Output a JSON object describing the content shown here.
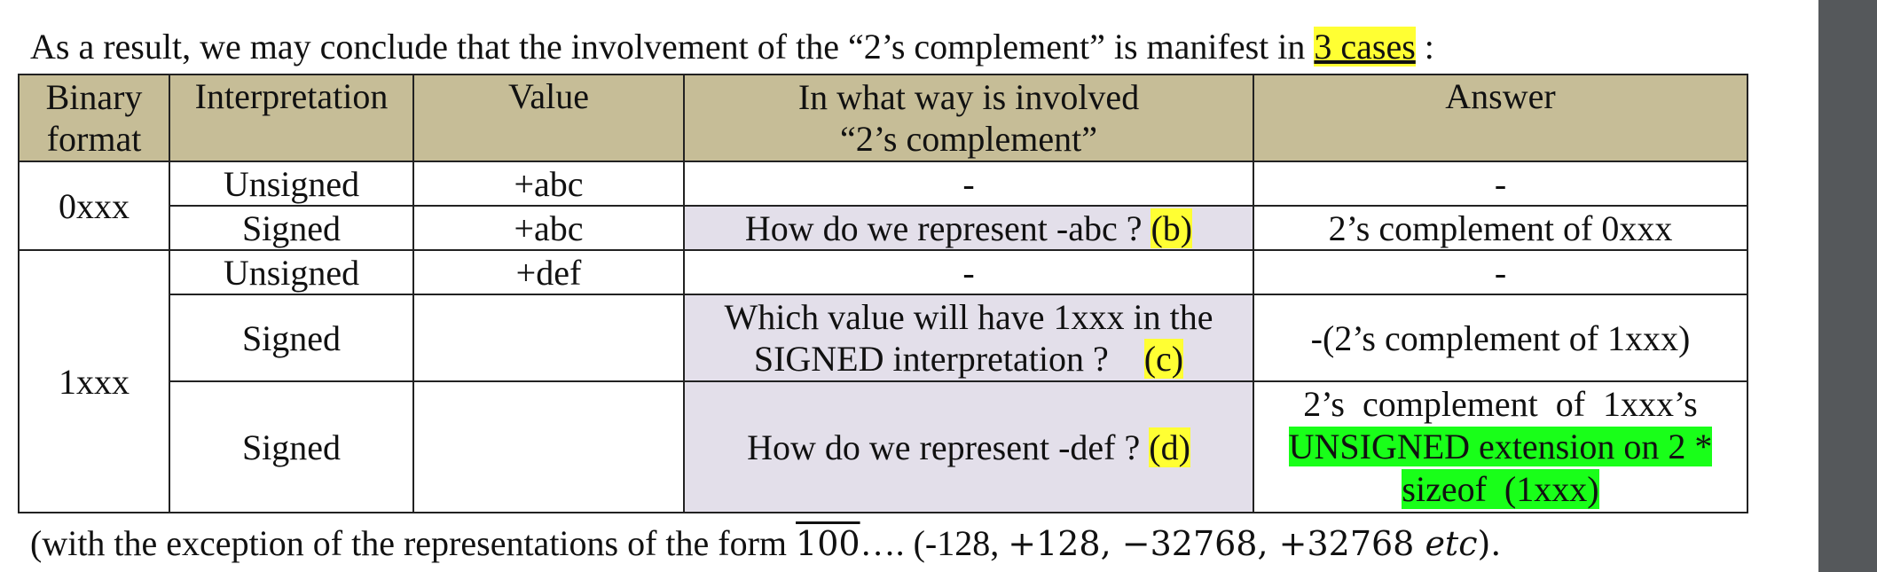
{
  "intro": {
    "text_before": "As a result, we may conclude that the involvement of the “2’s complement” is manifest in ",
    "highlight": "3 cases",
    "text_after": " :"
  },
  "table": {
    "headers": {
      "binary_format": "Binary format",
      "interpretation": "Interpretation",
      "value": "Value",
      "involved_line1": "In what way is involved",
      "involved_line2": "“2’s complement”",
      "answer": "Answer"
    },
    "rows": [
      {
        "binary": "0xxx",
        "interpretation": "Unsigned",
        "value": "+abc",
        "involved": "-",
        "answer": "-"
      },
      {
        "interpretation": "Signed",
        "value": "+abc",
        "involved": "How do we represent -abc ? ",
        "involved_tag": "(b)",
        "answer": "2’s  complement of  0xxx"
      },
      {
        "binary": "1xxx",
        "interpretation": "Unsigned",
        "value": "+def",
        "involved": "-",
        "answer": "-"
      },
      {
        "interpretation": "Signed",
        "value": "",
        "involved_line1": "Which value will have 1xxx in the",
        "involved_line2": "SIGNED interpretation ?    ",
        "involved_tag": "(c)",
        "answer": "-(2’s complement of 1xxx)"
      },
      {
        "interpretation": "Signed",
        "value": "",
        "involved": "How do we represent -def ? ",
        "involved_tag": "(d)",
        "answer_line1": "2’s  complement  of  1xxx’s",
        "answer_line2": "UNSIGNED extension on 2 *",
        "answer_line3": "sizeof  (1xxx)"
      }
    ]
  },
  "footer": {
    "text_before": "(with the exception of the representations of the form ",
    "overline_text": "100",
    "text_middle": "…. (-128, ",
    "math": "+128, −32768, +32768 ",
    "math_italic": "etc",
    "text_after": ")."
  },
  "colors": {
    "header_bg": "#c6bd97",
    "shaded_cell": "#e3dfea",
    "yellow_highlight": "#ffff33",
    "green_highlight": "#19ff19",
    "sidebar": "#55585b"
  }
}
